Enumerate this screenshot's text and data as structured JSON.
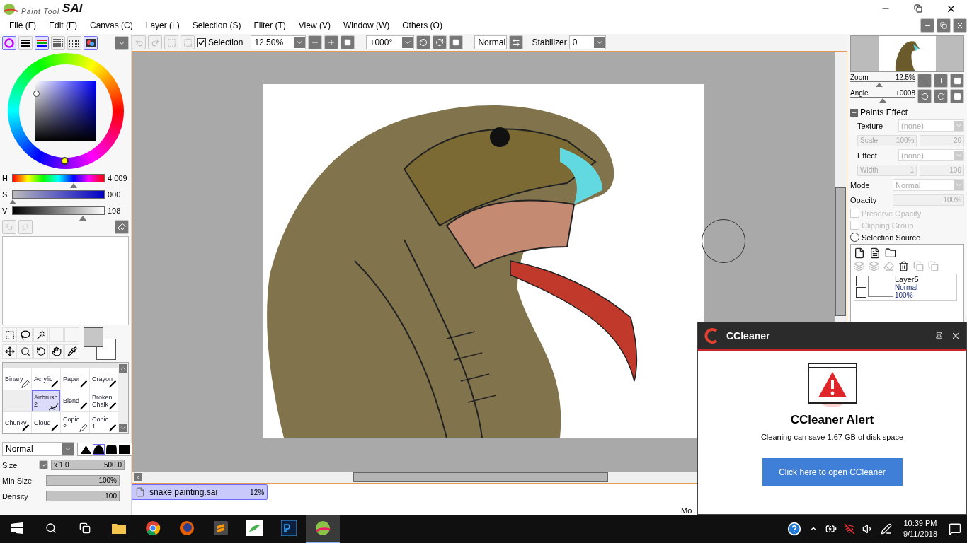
{
  "window": {
    "logo_small": "Paint Tool",
    "logo_large": "SAI"
  },
  "menu": [
    "File (F)",
    "Edit (E)",
    "Canvas (C)",
    "Layer (L)",
    "Selection (S)",
    "Filter (T)",
    "View (V)",
    "Window (W)",
    "Others (O)"
  ],
  "toolbar": {
    "color_modes": [
      {
        "kind": "wheel",
        "on": true
      },
      {
        "kind": "bars",
        "on": false
      },
      {
        "kind": "rgb",
        "on": true
      },
      {
        "kind": "list",
        "on": false
      },
      {
        "kind": "grid",
        "on": false
      },
      {
        "kind": "mixer",
        "on": true
      }
    ],
    "selection": {
      "label": "Selection",
      "checked": true
    },
    "zoom": "12.50%",
    "angle": "+000°",
    "blend": "Normal",
    "stabilizer": {
      "label": "Stabilizer",
      "value": "0"
    }
  },
  "color": {
    "sliders": [
      {
        "label": "H",
        "kind": "hue",
        "level": 0.67,
        "reading": "4:009"
      },
      {
        "label": "S",
        "kind": "saturation",
        "level": 0.0,
        "reading": "000"
      },
      {
        "label": "V",
        "kind": "value",
        "level": 0.77,
        "reading": "198"
      }
    ]
  },
  "brushes": [
    {
      "label": "Binary",
      "kind": "pencil",
      "selected": false
    },
    {
      "label": "Acrylic",
      "kind": "pen",
      "selected": false
    },
    {
      "label": "Paper",
      "kind": "pen",
      "selected": false
    },
    {
      "label": "Crayon",
      "kind": "pen",
      "selected": false
    },
    {
      "kind": "empty",
      "selected": false
    },
    {
      "label": "Airbrush\n2",
      "kind": "airbrush",
      "selected": true
    },
    {
      "label": "Blend",
      "kind": "pen",
      "selected": false
    },
    {
      "label": "Broken\nChalk",
      "kind": "pen",
      "selected": false
    },
    {
      "label": "Chunky",
      "kind": "pen",
      "selected": false
    },
    {
      "label": "Cloud",
      "kind": "pen",
      "selected": false
    },
    {
      "label": "Copic\n2",
      "kind": "pencil",
      "selected": false
    },
    {
      "label": "Copic\n1",
      "kind": "pen",
      "selected": false
    }
  ],
  "brush_mode": "Normal",
  "brush_shapes": [
    {
      "selected": false
    },
    {
      "selected": true
    },
    {
      "selected": false
    },
    {
      "selected": false
    }
  ],
  "brush_settings": [
    {
      "label": "Size",
      "kind": "size",
      "multiplier": "x 1.0",
      "reading": "500.0",
      "level": 1
    },
    {
      "label": "Min Size",
      "kind": "plain",
      "reading": "100%",
      "level": 1
    },
    {
      "label": "Density",
      "kind": "plain",
      "reading": "100",
      "level": 1
    }
  ],
  "canvas": {
    "tabs": [
      {
        "name": "snake painting.sai",
        "zoom": "12%",
        "selected": true
      }
    ],
    "status": "Mo"
  },
  "navigator": {
    "zoom": {
      "label": "Zoom",
      "reading": "12.5%",
      "level": 0.45
    },
    "angle": {
      "label": "Angle",
      "reading": "+0008",
      "level": 0.5
    }
  },
  "paints_effect": {
    "title": "Paints Effect",
    "expanded": true,
    "texture": {
      "label": "Texture",
      "value": "(none)"
    },
    "scale": {
      "label": "Scale",
      "reading": "100%",
      "extra": "20"
    },
    "effect": {
      "label": "Effect",
      "value": "(none)"
    },
    "width": {
      "label": "Width",
      "reading": "1",
      "extra": "100"
    }
  },
  "layer_props": {
    "mode": {
      "label": "Mode",
      "value": "Normal"
    },
    "opacity": {
      "label": "Opacity",
      "reading": "100%"
    },
    "options": [
      {
        "label": "Preserve Opacity",
        "kind": "checkbox",
        "checked": false,
        "disabled": true
      },
      {
        "label": "Clipping Group",
        "kind": "checkbox",
        "checked": false,
        "disabled": true
      },
      {
        "label": "Selection Source",
        "kind": "radio",
        "checked": false,
        "disabled": false
      }
    ]
  },
  "layers": [
    {
      "name": "Layer5",
      "mode": "Normal",
      "opacity": "100%",
      "visible": false,
      "locked": false
    }
  ],
  "popup": {
    "title": "CCleaner",
    "heading": "CCleaner Alert",
    "message": "Cleaning can save 1.67 GB of disk space",
    "button": "Click here to open CCleaner"
  },
  "taskbar": {
    "apps": [
      {
        "kind": "folder",
        "active": false
      },
      {
        "kind": "chrome",
        "active": false
      },
      {
        "kind": "firefox",
        "active": false
      },
      {
        "kind": "sublime",
        "active": false
      },
      {
        "kind": "leaf",
        "active": false
      },
      {
        "kind": "ps",
        "active": false
      },
      {
        "kind": "sai",
        "active": true
      }
    ],
    "time": "10:39 PM",
    "date": "9/11/2018"
  }
}
